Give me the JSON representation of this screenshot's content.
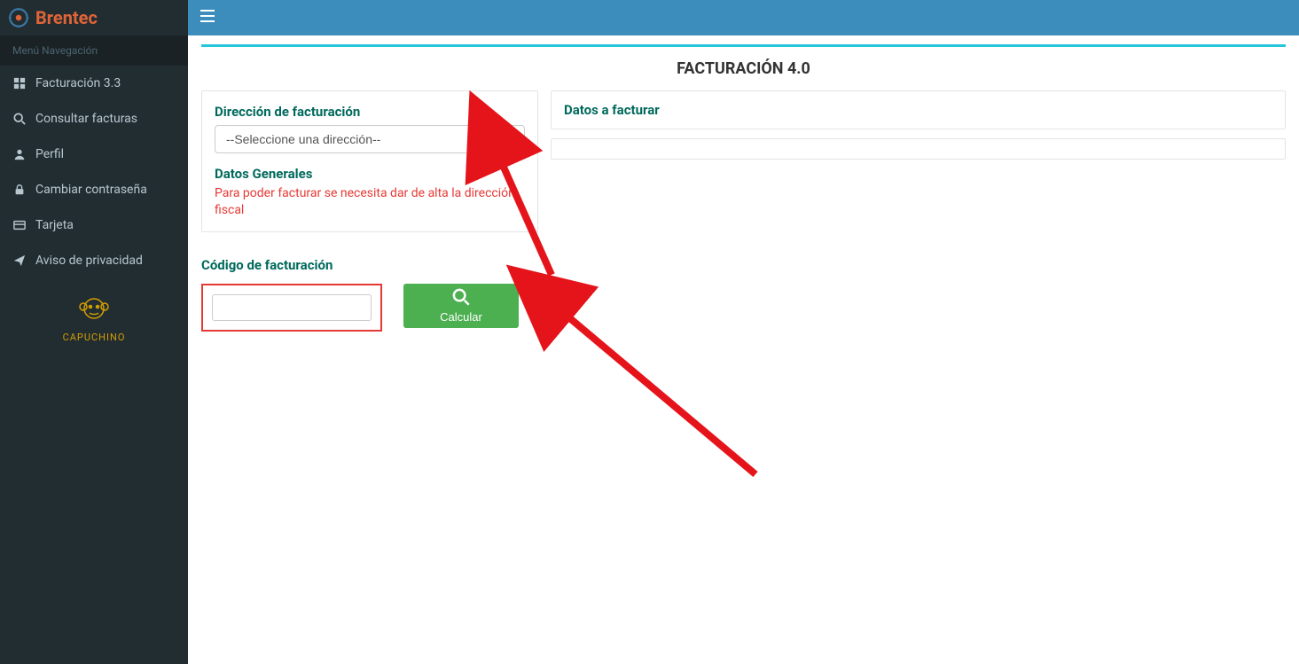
{
  "brand": {
    "name": "Brentec"
  },
  "sidebar": {
    "section_label": "Menú Navegación",
    "items": [
      {
        "icon": "grid-icon",
        "label": "Facturación 3.3"
      },
      {
        "icon": "search-icon",
        "label": "Consultar facturas"
      },
      {
        "icon": "user-icon",
        "label": "Perfil"
      },
      {
        "icon": "lock-icon",
        "label": "Cambiar contraseña"
      },
      {
        "icon": "card-icon",
        "label": "Tarjeta"
      },
      {
        "icon": "send-icon",
        "label": "Aviso de privacidad"
      }
    ],
    "footer_label": "CAPUCHINO"
  },
  "page": {
    "title": "FACTURACIÓN 4.0"
  },
  "billing_address": {
    "heading": "Dirección de facturación",
    "placeholder": "--Seleccione una dirección--"
  },
  "general_data": {
    "heading": "Datos Generales",
    "warning": "Para poder facturar se necesita dar de alta la dirección fiscal"
  },
  "billing_code": {
    "heading": "Código de facturación",
    "value": "",
    "button_label": "Calcular"
  },
  "right_panel": {
    "heading": "Datos a facturar"
  }
}
